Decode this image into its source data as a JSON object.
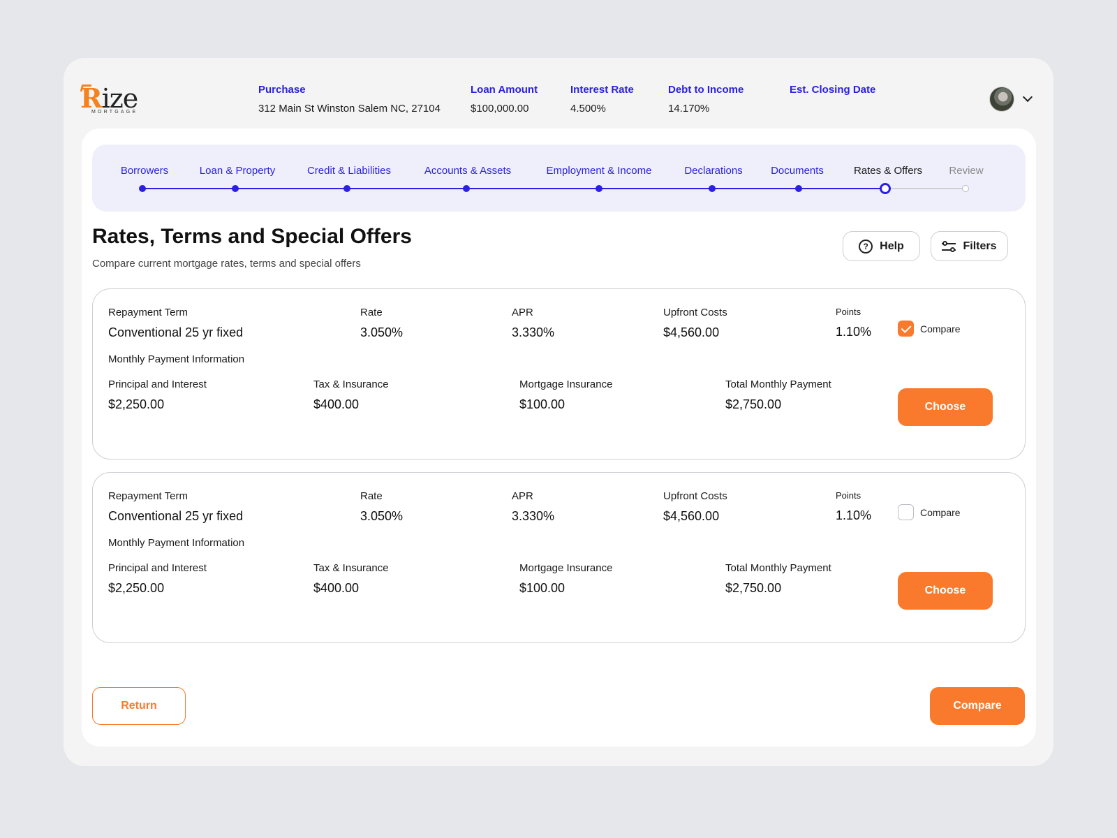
{
  "brand": {
    "logo_word": "Rize",
    "logo_sub": "MORTGAGE",
    "accent": "#f97a2c",
    "primary": "#2b20e0"
  },
  "summary": [
    {
      "label": "Purchase",
      "value": "312 Main St Winston Salem NC, 27104"
    },
    {
      "label": "Loan Amount",
      "value": "$100,000.00"
    },
    {
      "label": "Interest Rate",
      "value": "4.500%"
    },
    {
      "label": "Debt to Income",
      "value": "14.170%"
    },
    {
      "label": "Est. Closing Date",
      "value": ""
    }
  ],
  "user": {
    "avatar_icon": "user-avatar",
    "menu_icon": "chevron-down-icon"
  },
  "steps": [
    {
      "label": "Borrowers",
      "state": "done"
    },
    {
      "label": "Loan & Property",
      "state": "done"
    },
    {
      "label": "Credit & Liabilities",
      "state": "done"
    },
    {
      "label": "Accounts & Assets",
      "state": "done"
    },
    {
      "label": "Employment & Income",
      "state": "done"
    },
    {
      "label": "Declarations",
      "state": "done"
    },
    {
      "label": "Documents",
      "state": "done"
    },
    {
      "label": "Rates & Offers",
      "state": "current"
    },
    {
      "label": "Review",
      "state": "todo"
    }
  ],
  "page": {
    "title": "Rates, Terms and Special Offers",
    "subtitle": "Compare current mortgage rates, terms and special offers",
    "help_label": "Help",
    "filters_label": "Filters"
  },
  "offers": [
    {
      "repayment_term_label": "Repayment Term",
      "repayment_term": "Conventional 25 yr fixed",
      "rate_label": "Rate",
      "rate": "3.050%",
      "apr_label": "APR",
      "apr": "3.330%",
      "upfront_label": "Upfront Costs",
      "upfront": "$4,560.00",
      "points_label": "Points",
      "points": "1.10%",
      "compare_label": "Compare",
      "compare_checked": true,
      "monthly_label": "Monthly Payment Information",
      "pi_label": "Principal and Interest",
      "pi": "$2,250.00",
      "tax_label": "Tax & Insurance",
      "tax": "$400.00",
      "mi_label": "Mortgage Insurance",
      "mi": "$100.00",
      "total_label": "Total Monthly Payment",
      "total": "$2,750.00",
      "choose_label": "Choose"
    },
    {
      "repayment_term_label": "Repayment Term",
      "repayment_term": "Conventional 25 yr fixed",
      "rate_label": "Rate",
      "rate": "3.050%",
      "apr_label": "APR",
      "apr": "3.330%",
      "upfront_label": "Upfront Costs",
      "upfront": "$4,560.00",
      "points_label": "Points",
      "points": "1.10%",
      "compare_label": "Compare",
      "compare_checked": false,
      "monthly_label": "Monthly Payment Information",
      "pi_label": "Principal and Interest",
      "pi": "$2,250.00",
      "tax_label": "Tax & Insurance",
      "tax": "$400.00",
      "mi_label": "Mortgage Insurance",
      "mi": "$100.00",
      "total_label": "Total Monthly Payment",
      "total": "$2,750.00",
      "choose_label": "Choose"
    }
  ],
  "footer": {
    "return_label": "Return",
    "compare_label": "Compare"
  }
}
